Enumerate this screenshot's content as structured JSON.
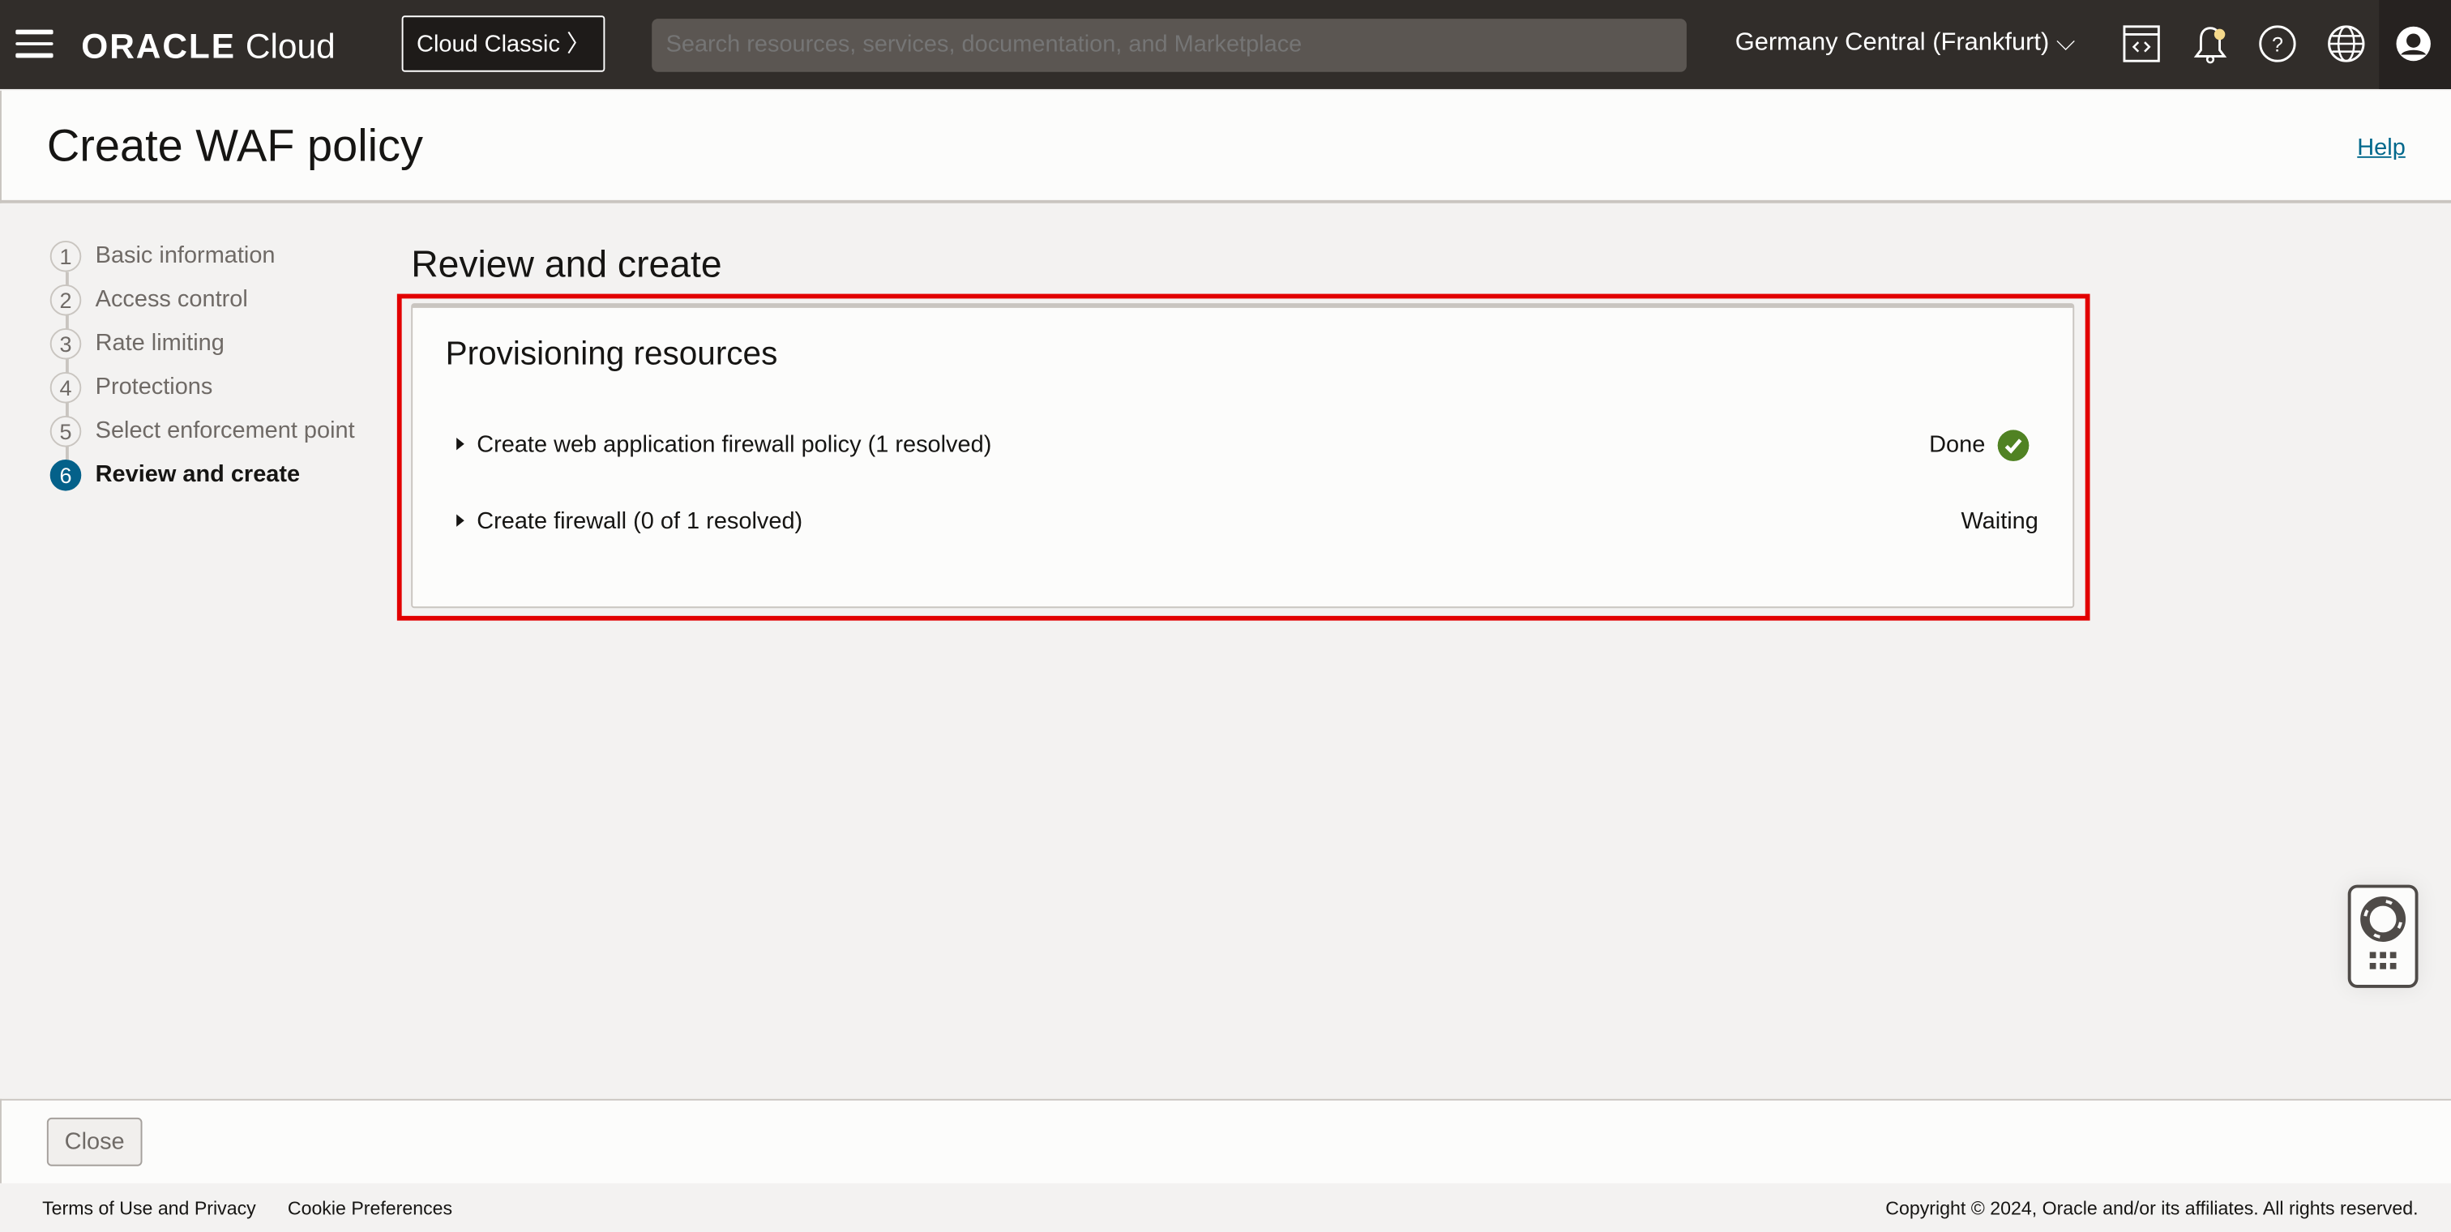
{
  "header": {
    "brand": "ORACLE",
    "brand_suffix": "Cloud",
    "cloud_classic": "Cloud Classic",
    "search_placeholder": "Search resources, services, documentation, and Marketplace",
    "region": "Germany Central (Frankfurt)",
    "notification_dot_color": "#f5d98b"
  },
  "page": {
    "title": "Create WAF policy",
    "help": "Help"
  },
  "steps": [
    {
      "num": "1",
      "label": "Basic information"
    },
    {
      "num": "2",
      "label": "Access control"
    },
    {
      "num": "3",
      "label": "Rate limiting"
    },
    {
      "num": "4",
      "label": "Protections"
    },
    {
      "num": "5",
      "label": "Select enforcement point"
    },
    {
      "num": "6",
      "label": "Review and create",
      "active": true
    }
  ],
  "main": {
    "heading": "Review and create",
    "card_title": "Provisioning resources",
    "rows": [
      {
        "label": "Create web application firewall policy (1 resolved)",
        "status": "Done"
      },
      {
        "label": "Create firewall (0 of 1 resolved)",
        "status": "Waiting"
      }
    ]
  },
  "actions": {
    "close": "Close"
  },
  "footer": {
    "terms": "Terms of Use and Privacy",
    "cookies": "Cookie Preferences",
    "copyright": "Copyright © 2024, Oracle and/or its affiliates. All rights reserved."
  },
  "colors": {
    "accent": "#04618a",
    "success": "#508223",
    "highlight": "#e20000"
  }
}
